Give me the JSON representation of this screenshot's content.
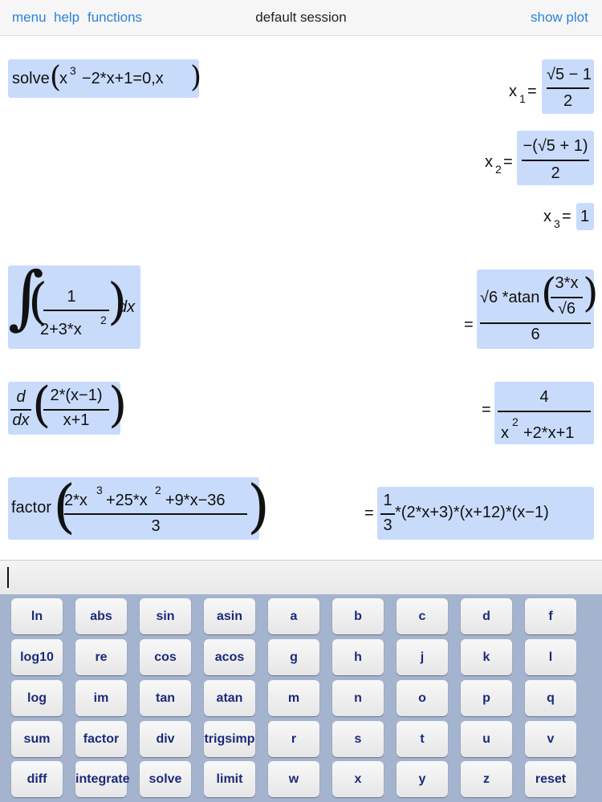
{
  "header": {
    "menu": "menu",
    "help": "help",
    "functions": "functions",
    "title": "default session",
    "show_plot": "show plot"
  },
  "entries": {
    "solve": {
      "fn": "solve",
      "poly_a": "x",
      "exp3": "3",
      "poly_b": "−2*x+1=0,x",
      "x1_label": "x",
      "x1_sub": "1",
      "x1_eq": "=",
      "x1_num": "√5 − 1",
      "x1_den": "2",
      "x2_label": "x",
      "x2_sub": "2",
      "x2_eq": "=",
      "x2_num": "−(√5 + 1)",
      "x2_den": "2",
      "x3_label": "x",
      "x3_sub": "3",
      "x3_eq": "=",
      "x3_val": "1"
    },
    "integral": {
      "num": "1",
      "den": "2+3*x",
      "den_exp": "2",
      "dx": "dx",
      "eq": "=",
      "res_pre": "√6 *atan",
      "res_inner_num": "3*x",
      "res_inner_den": "√6",
      "res_den": "6"
    },
    "derivative": {
      "d_num": "d",
      "d_den": "dx",
      "num": "2*(x−1)",
      "den": "x+1",
      "eq": "=",
      "res_num": "4",
      "res_den_a": "x",
      "res_den_exp": "2",
      "res_den_b": "+2*x+1"
    },
    "factor": {
      "fn": "factor",
      "num_a": "2*x",
      "num_exp1": "3",
      "num_b": "+25*x",
      "num_exp2": "2",
      "num_c": "+9*x−36",
      "den": "3",
      "eq": "=",
      "res_num": "1",
      "res_den": "3",
      "res_rest": "*(2*x+3)*(x+12)*(x−1)"
    }
  },
  "keyboard": {
    "keys": [
      "ln",
      "abs",
      "sin",
      "asin",
      "a",
      "b",
      "c",
      "d",
      "f",
      "log10",
      "re",
      "cos",
      "acos",
      "g",
      "h",
      "j",
      "k",
      "l",
      "log",
      "im",
      "tan",
      "atan",
      "m",
      "n",
      "o",
      "p",
      "q",
      "sum",
      "factor",
      "div",
      "trigsimp",
      "r",
      "s",
      "t",
      "u",
      "v",
      "diff",
      "integrate",
      "solve",
      "limit",
      "w",
      "x",
      "y",
      "z",
      "reset"
    ]
  }
}
